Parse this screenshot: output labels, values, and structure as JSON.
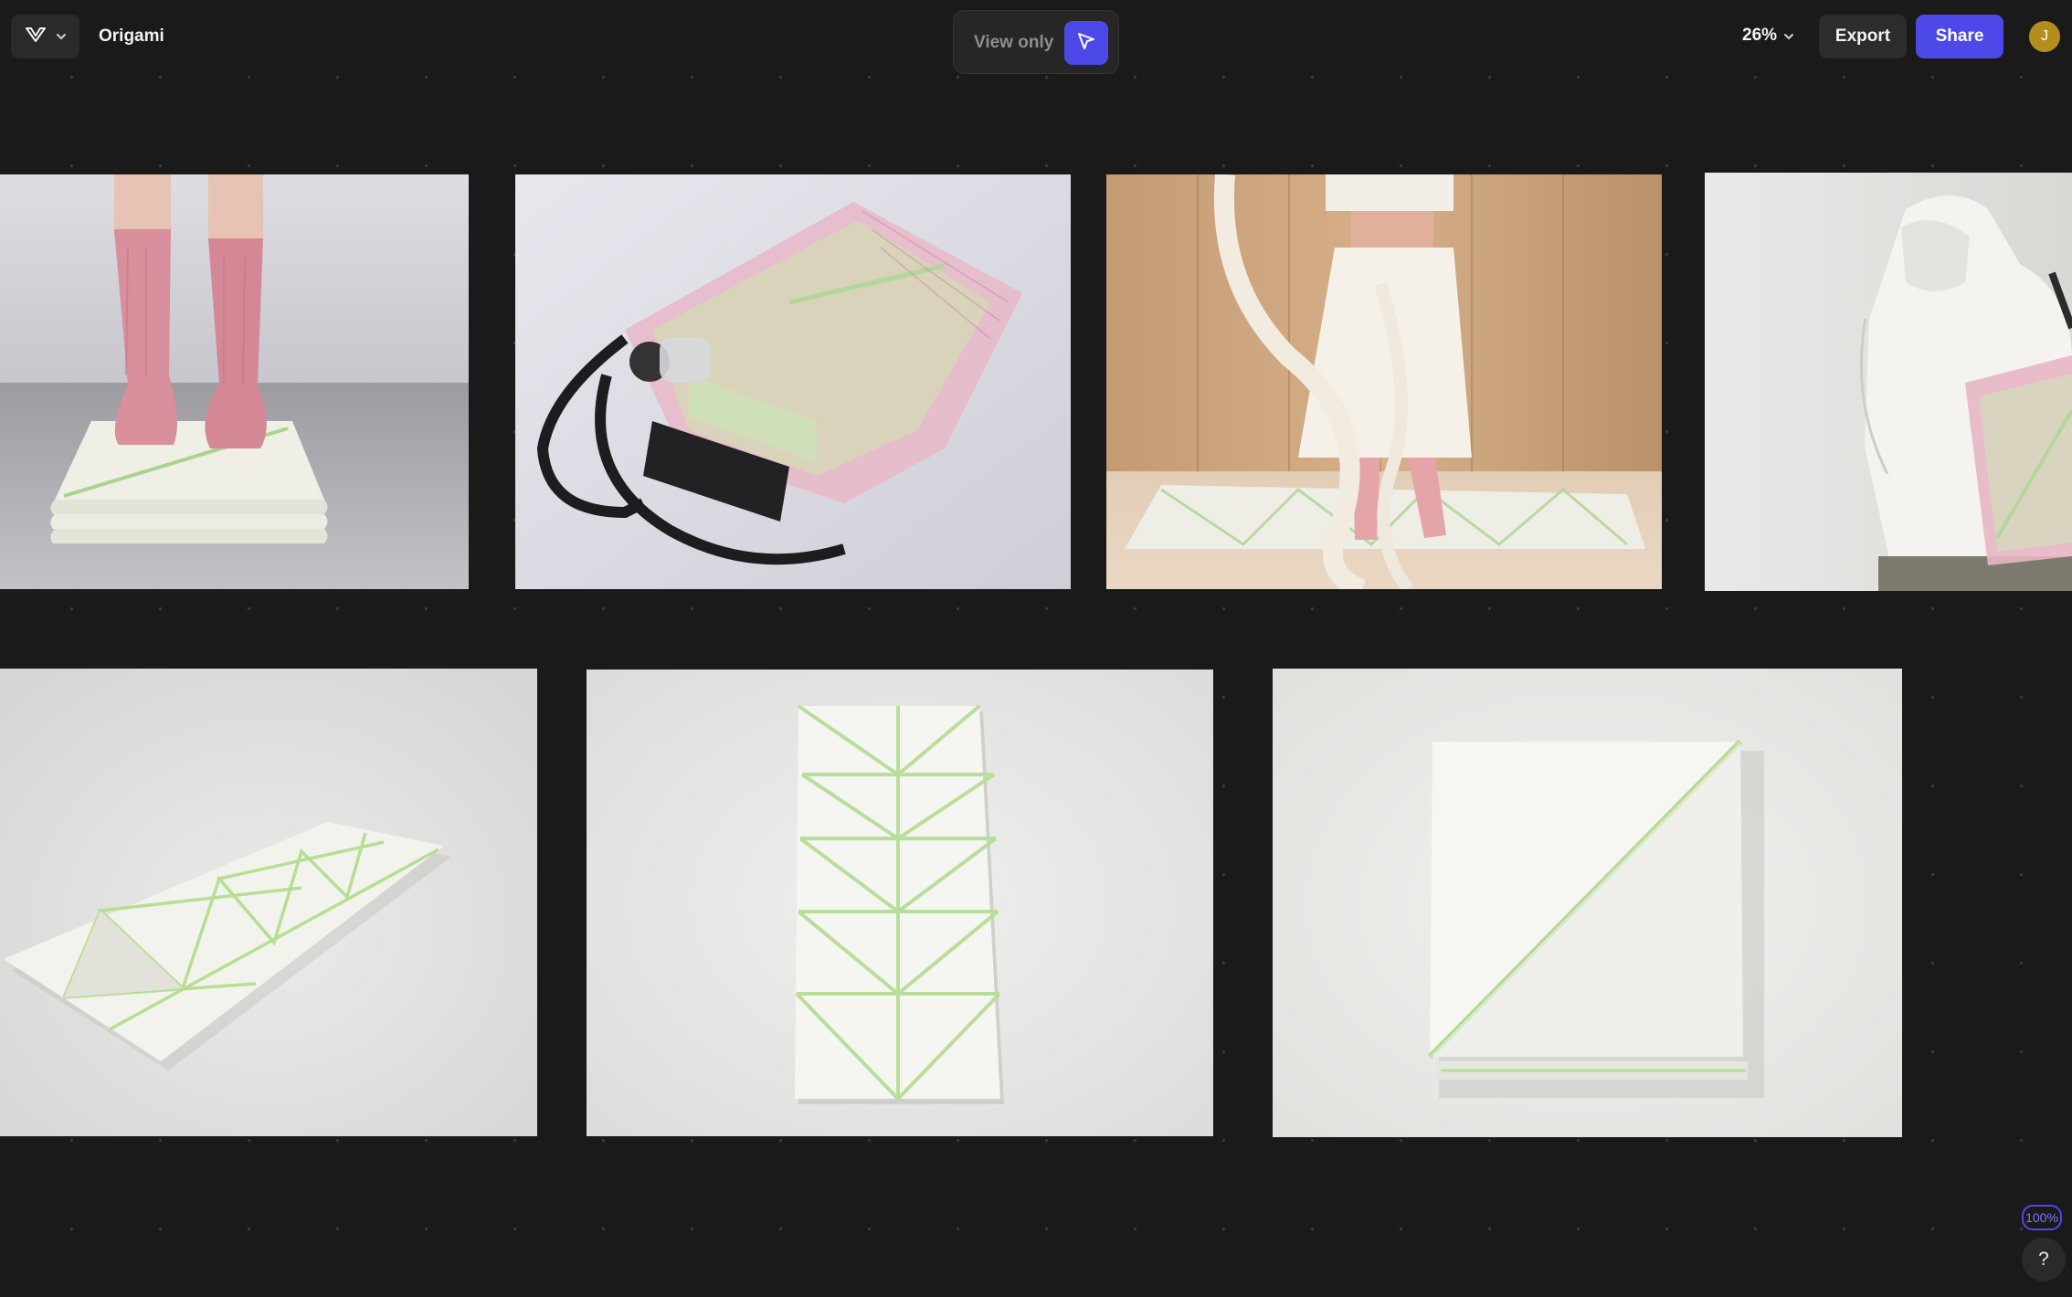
{
  "header": {
    "file_title": "Origami",
    "view_only_label": "View only",
    "zoom_level": "26%",
    "export_label": "Export",
    "share_label": "Share",
    "avatar_initial": "J"
  },
  "footer": {
    "zoom_badge": "100%",
    "help_label": "?"
  },
  "colors": {
    "accent": "#4d48e8",
    "canvas": "#1a1a1a",
    "avatar": "#b58d1c"
  },
  "icons": [
    "logo-icon",
    "chevron-down-icon",
    "cursor-arrow-icon"
  ],
  "images": [
    {
      "subject": "pink socks on folded green-lined mat"
    },
    {
      "subject": "pink mesh tote bag with folded mat, bottle and notebook"
    },
    {
      "subject": "dancer with ribbon on unfolded mat"
    },
    {
      "subject": "person in white hoodie carrying mat bag"
    },
    {
      "subject": "mat unfolded at angle"
    },
    {
      "subject": "mat unfolded flat top view"
    },
    {
      "subject": "mat folded into square"
    }
  ]
}
